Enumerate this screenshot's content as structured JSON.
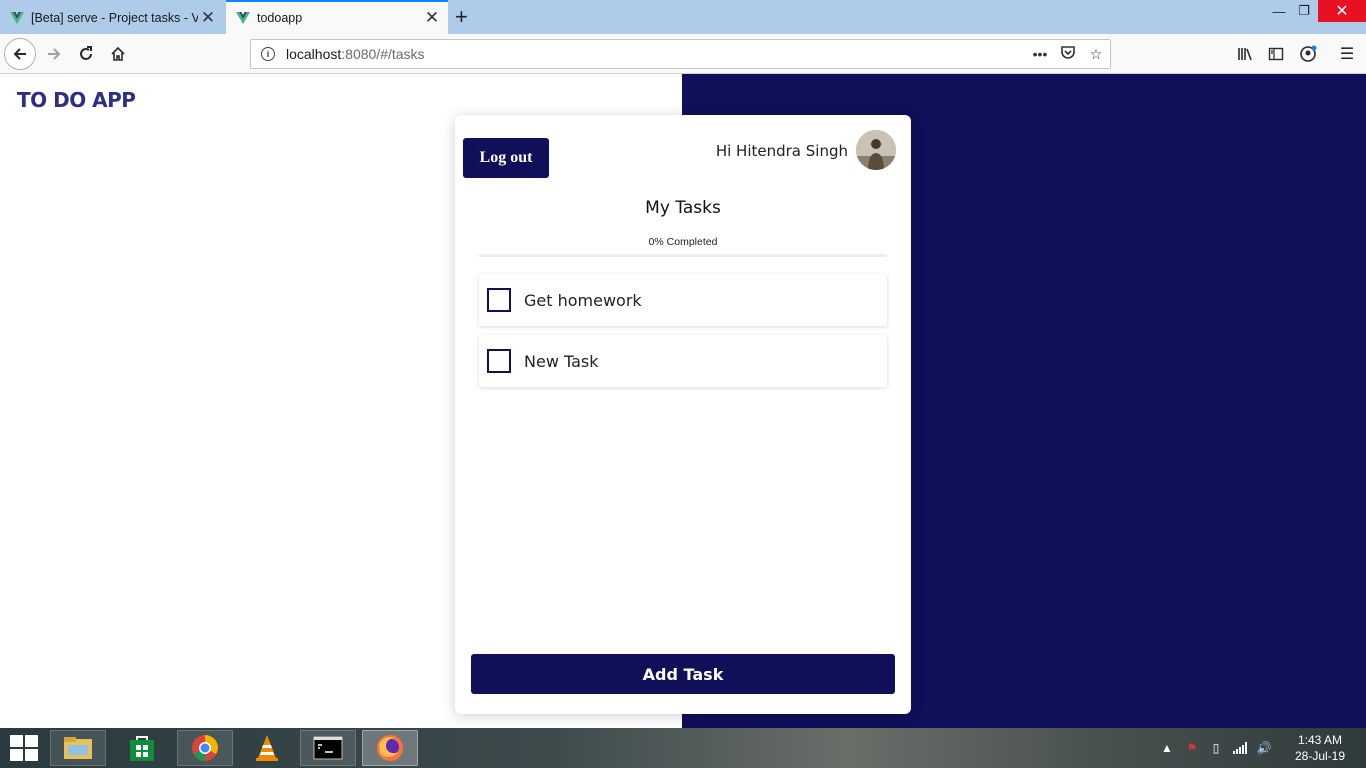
{
  "browser": {
    "tabs": [
      {
        "title": "[Beta] serve - Project tasks - Vu",
        "active": false
      },
      {
        "title": "todoapp",
        "active": true
      }
    ],
    "url_host": "localhost",
    "url_rest": ":8080/#/tasks",
    "icons": {
      "back": "back-arrow-icon",
      "forward": "forward-arrow-icon",
      "reload": "reload-icon",
      "home": "home-icon",
      "page_actions": "ellipsis-icon",
      "pocket": "pocket-icon",
      "bookmark": "star-icon",
      "library": "library-icon",
      "sidebar": "sidebar-icon",
      "sync": "account-icon",
      "menu": "hamburger-menu-icon"
    }
  },
  "app": {
    "logo": "TO DO APP",
    "logout_label": "Log out",
    "greeting": "Hi Hitendra Singh",
    "title": "My Tasks",
    "progress_label": "0% Completed",
    "progress_fraction": 0,
    "tasks": [
      {
        "label": "Get homework",
        "done": false
      },
      {
        "label": "New Task",
        "done": false
      }
    ],
    "add_task_label": "Add Task"
  },
  "colors": {
    "primary": "#0f0f5a",
    "logo": "#2d2e86",
    "tab_accent": "#0a84ff",
    "window_close": "#e81123"
  },
  "taskbar": {
    "apps": [
      "file-explorer-icon",
      "store-icon",
      "chrome-icon",
      "vlc-icon",
      "command-prompt-icon",
      "firefox-icon"
    ],
    "time": "1:43 AM",
    "date": "28-Jul-19"
  }
}
